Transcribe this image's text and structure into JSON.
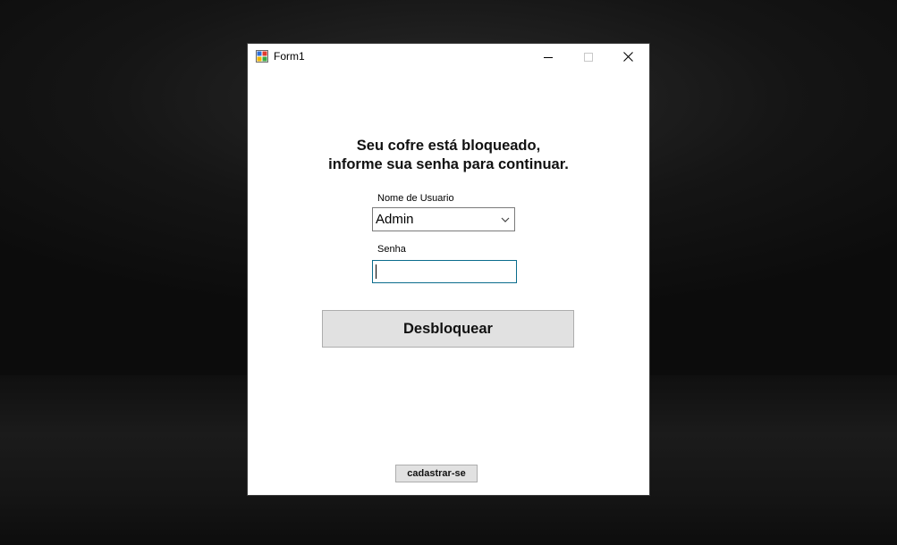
{
  "window": {
    "title": "Form1",
    "title_icon": "winforms-app-icon",
    "controls": {
      "minimize_icon": "minimize-icon",
      "maximize_icon": "maximize-icon",
      "close_icon": "close-icon"
    }
  },
  "form": {
    "heading_line1": "Seu cofre está bloqueado,",
    "heading_line2": "informe sua senha para continuar.",
    "username_label": "Nome de Usuario",
    "username_value": "Admin",
    "password_label": "Senha",
    "password_value": "",
    "unlock_button": "Desbloquear",
    "signup_button": "cadastrar-se"
  },
  "colors": {
    "window_bg": "#ffffff",
    "button_bg": "#e1e1e1",
    "focus_border": "#0a6c8c",
    "desktop_bg": "#151515"
  }
}
